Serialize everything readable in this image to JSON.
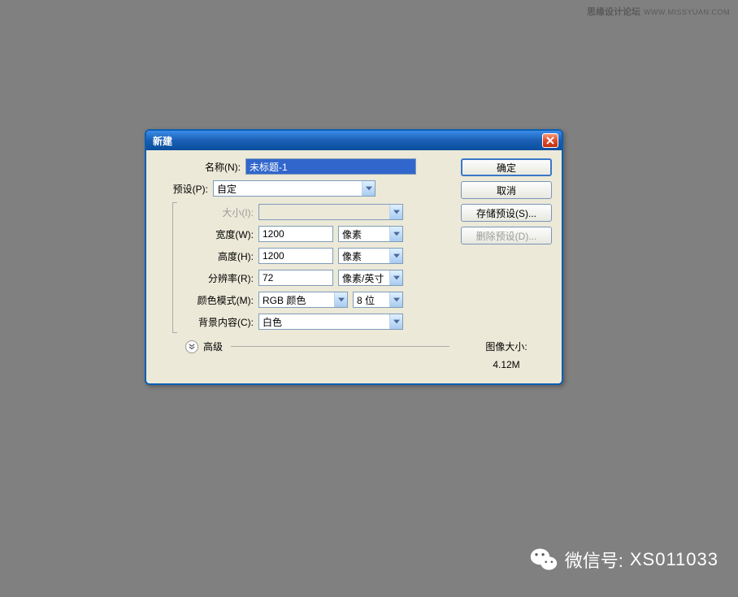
{
  "watermark": {
    "site_cn": "思缘设计论坛",
    "site_url": "WWW.MISSYUAN.COM"
  },
  "dialog": {
    "title": "新建",
    "labels": {
      "name": "名称(N):",
      "preset": "预设(P):",
      "size": "大小(I):",
      "width": "宽度(W):",
      "height": "高度(H):",
      "resolution": "分辨率(R):",
      "color_mode": "颜色模式(M):",
      "bg_content": "背景内容(C):",
      "advanced": "高级"
    },
    "values": {
      "name": "未标题-1",
      "preset": "自定",
      "size": "",
      "width": "1200",
      "height": "1200",
      "resolution": "72",
      "color_mode": "RGB 颜色",
      "bit_depth": "8 位",
      "bg_content": "白色"
    },
    "units": {
      "width": "像素",
      "height": "像素",
      "resolution": "像素/英寸"
    },
    "buttons": {
      "ok": "确定",
      "cancel": "取消",
      "save_preset": "存储预设(S)...",
      "delete_preset": "删除预设(D)..."
    },
    "info": {
      "image_size_label": "图像大小:",
      "image_size_value": "4.12M"
    }
  },
  "wechat": {
    "label": "微信号:",
    "id": "XS011033"
  }
}
